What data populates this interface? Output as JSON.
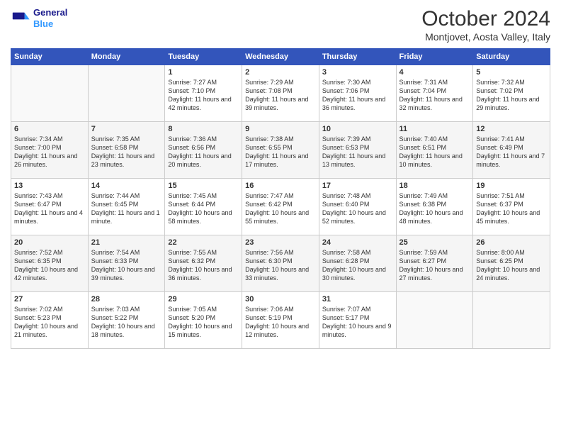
{
  "header": {
    "logo_line1": "General",
    "logo_line2": "Blue",
    "month_title": "October 2024",
    "location": "Montjovet, Aosta Valley, Italy"
  },
  "weekdays": [
    "Sunday",
    "Monday",
    "Tuesday",
    "Wednesday",
    "Thursday",
    "Friday",
    "Saturday"
  ],
  "weeks": [
    [
      {
        "day": "",
        "empty": true
      },
      {
        "day": "",
        "empty": true
      },
      {
        "day": "1",
        "sunrise": "7:27 AM",
        "sunset": "7:10 PM",
        "daylight": "11 hours and 42 minutes."
      },
      {
        "day": "2",
        "sunrise": "7:29 AM",
        "sunset": "7:08 PM",
        "daylight": "11 hours and 39 minutes."
      },
      {
        "day": "3",
        "sunrise": "7:30 AM",
        "sunset": "7:06 PM",
        "daylight": "11 hours and 36 minutes."
      },
      {
        "day": "4",
        "sunrise": "7:31 AM",
        "sunset": "7:04 PM",
        "daylight": "11 hours and 32 minutes."
      },
      {
        "day": "5",
        "sunrise": "7:32 AM",
        "sunset": "7:02 PM",
        "daylight": "11 hours and 29 minutes."
      }
    ],
    [
      {
        "day": "6",
        "sunrise": "7:34 AM",
        "sunset": "7:00 PM",
        "daylight": "11 hours and 26 minutes."
      },
      {
        "day": "7",
        "sunrise": "7:35 AM",
        "sunset": "6:58 PM",
        "daylight": "11 hours and 23 minutes."
      },
      {
        "day": "8",
        "sunrise": "7:36 AM",
        "sunset": "6:56 PM",
        "daylight": "11 hours and 20 minutes."
      },
      {
        "day": "9",
        "sunrise": "7:38 AM",
        "sunset": "6:55 PM",
        "daylight": "11 hours and 17 minutes."
      },
      {
        "day": "10",
        "sunrise": "7:39 AM",
        "sunset": "6:53 PM",
        "daylight": "11 hours and 13 minutes."
      },
      {
        "day": "11",
        "sunrise": "7:40 AM",
        "sunset": "6:51 PM",
        "daylight": "11 hours and 10 minutes."
      },
      {
        "day": "12",
        "sunrise": "7:41 AM",
        "sunset": "6:49 PM",
        "daylight": "11 hours and 7 minutes."
      }
    ],
    [
      {
        "day": "13",
        "sunrise": "7:43 AM",
        "sunset": "6:47 PM",
        "daylight": "11 hours and 4 minutes."
      },
      {
        "day": "14",
        "sunrise": "7:44 AM",
        "sunset": "6:45 PM",
        "daylight": "11 hours and 1 minute."
      },
      {
        "day": "15",
        "sunrise": "7:45 AM",
        "sunset": "6:44 PM",
        "daylight": "10 hours and 58 minutes."
      },
      {
        "day": "16",
        "sunrise": "7:47 AM",
        "sunset": "6:42 PM",
        "daylight": "10 hours and 55 minutes."
      },
      {
        "day": "17",
        "sunrise": "7:48 AM",
        "sunset": "6:40 PM",
        "daylight": "10 hours and 52 minutes."
      },
      {
        "day": "18",
        "sunrise": "7:49 AM",
        "sunset": "6:38 PM",
        "daylight": "10 hours and 48 minutes."
      },
      {
        "day": "19",
        "sunrise": "7:51 AM",
        "sunset": "6:37 PM",
        "daylight": "10 hours and 45 minutes."
      }
    ],
    [
      {
        "day": "20",
        "sunrise": "7:52 AM",
        "sunset": "6:35 PM",
        "daylight": "10 hours and 42 minutes."
      },
      {
        "day": "21",
        "sunrise": "7:54 AM",
        "sunset": "6:33 PM",
        "daylight": "10 hours and 39 minutes."
      },
      {
        "day": "22",
        "sunrise": "7:55 AM",
        "sunset": "6:32 PM",
        "daylight": "10 hours and 36 minutes."
      },
      {
        "day": "23",
        "sunrise": "7:56 AM",
        "sunset": "6:30 PM",
        "daylight": "10 hours and 33 minutes."
      },
      {
        "day": "24",
        "sunrise": "7:58 AM",
        "sunset": "6:28 PM",
        "daylight": "10 hours and 30 minutes."
      },
      {
        "day": "25",
        "sunrise": "7:59 AM",
        "sunset": "6:27 PM",
        "daylight": "10 hours and 27 minutes."
      },
      {
        "day": "26",
        "sunrise": "8:00 AM",
        "sunset": "6:25 PM",
        "daylight": "10 hours and 24 minutes."
      }
    ],
    [
      {
        "day": "27",
        "sunrise": "7:02 AM",
        "sunset": "5:23 PM",
        "daylight": "10 hours and 21 minutes."
      },
      {
        "day": "28",
        "sunrise": "7:03 AM",
        "sunset": "5:22 PM",
        "daylight": "10 hours and 18 minutes."
      },
      {
        "day": "29",
        "sunrise": "7:05 AM",
        "sunset": "5:20 PM",
        "daylight": "10 hours and 15 minutes."
      },
      {
        "day": "30",
        "sunrise": "7:06 AM",
        "sunset": "5:19 PM",
        "daylight": "10 hours and 12 minutes."
      },
      {
        "day": "31",
        "sunrise": "7:07 AM",
        "sunset": "5:17 PM",
        "daylight": "10 hours and 9 minutes."
      },
      {
        "day": "",
        "empty": true
      },
      {
        "day": "",
        "empty": true
      }
    ]
  ]
}
